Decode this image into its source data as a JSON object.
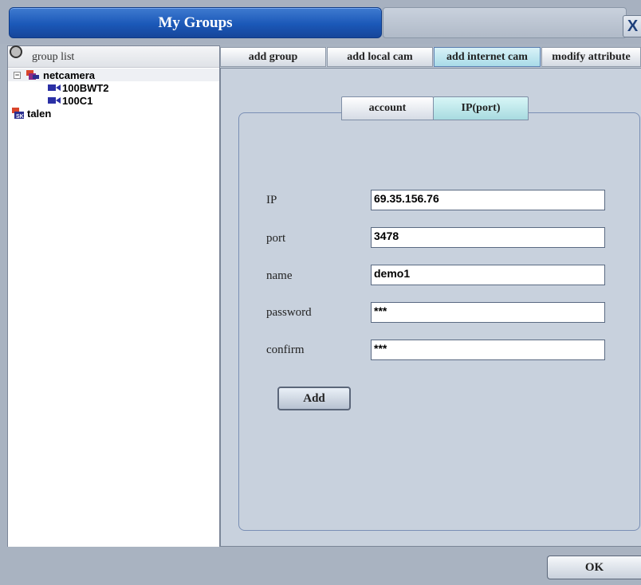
{
  "window": {
    "title": "My Groups",
    "close_label": "X"
  },
  "tree": {
    "header_label": "group list",
    "items": [
      {
        "label": "netcamera",
        "level": 0,
        "expanded": true,
        "icon": "camera-group-icon",
        "selected": true
      },
      {
        "label": "100BWT2",
        "level": 1,
        "icon": "video-camera-icon"
      },
      {
        "label": "100C1",
        "level": 1,
        "icon": "video-camera-icon"
      },
      {
        "label": "talen",
        "level": 0,
        "icon": "sk-group-icon"
      }
    ]
  },
  "tabs": [
    {
      "label": "add group",
      "active": false
    },
    {
      "label": "add local cam",
      "active": false
    },
    {
      "label": "add internet cam",
      "active": true
    },
    {
      "label": "modify attribute",
      "active": false
    }
  ],
  "subtabs": [
    {
      "label": "account",
      "active": false
    },
    {
      "label": "IP(port)",
      "active": true
    }
  ],
  "form": {
    "ip": {
      "label": "IP",
      "value": "69.35.156.76"
    },
    "port": {
      "label": "port",
      "value": "3478"
    },
    "name": {
      "label": "name",
      "value": "demo1"
    },
    "password": {
      "label": "password",
      "value": "***"
    },
    "confirm": {
      "label": "confirm",
      "value": "***"
    },
    "add_button": "Add"
  },
  "footer": {
    "ok_button": "OK"
  },
  "colors": {
    "title_blue": "#1b58b8",
    "active_tab": "#a9dbe8",
    "panel": "#c8d1dd"
  }
}
